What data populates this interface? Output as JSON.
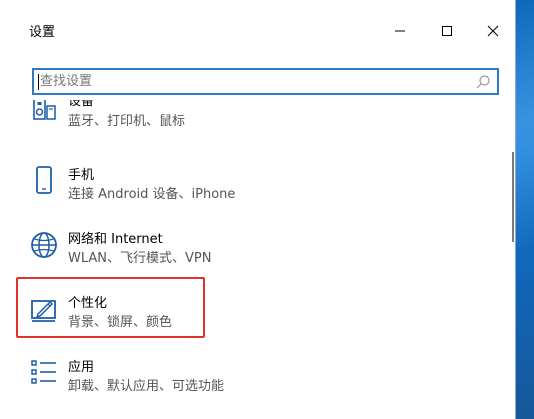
{
  "window": {
    "title": "设置",
    "buttons": {
      "minimize": "minimize-icon",
      "maximize": "maximize-icon",
      "close": "close-icon"
    }
  },
  "search": {
    "placeholder": "查找设置",
    "value": ""
  },
  "categories": [
    {
      "name": "设备",
      "description": "蓝牙、打印机、鼠标",
      "icon": "devices-icon",
      "partially_visible": true
    },
    {
      "name": "手机",
      "description": "连接 Android 设备、iPhone",
      "icon": "phone-icon"
    },
    {
      "name": "网络和 Internet",
      "description": "WLAN、飞行模式、VPN",
      "icon": "globe-icon"
    },
    {
      "name": "个性化",
      "description": "背景、锁屏、颜色",
      "icon": "personalization-icon",
      "highlighted": true
    },
    {
      "name": "应用",
      "description": "卸载、默认应用、可选功能",
      "icon": "apps-icon"
    }
  ],
  "colors": {
    "accent": "#2e7bc4",
    "icon": "#1f5ea8",
    "highlight_border": "#e0322d"
  }
}
